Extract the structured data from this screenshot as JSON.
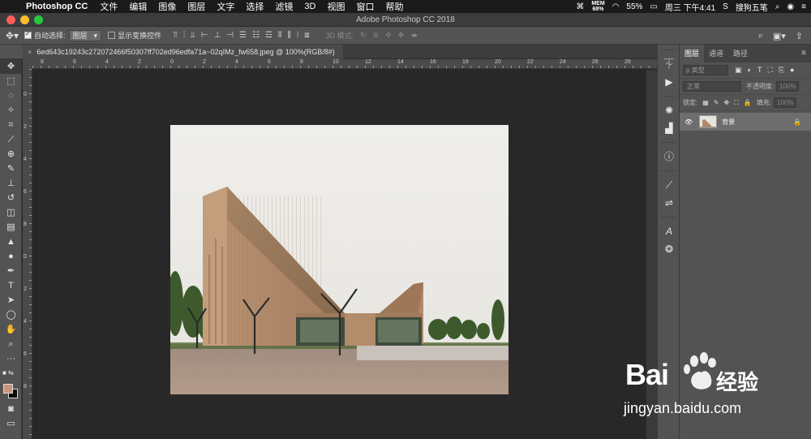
{
  "menubar": {
    "app_name": "Photoshop CC",
    "items": [
      "文件",
      "编辑",
      "图像",
      "图层",
      "文字",
      "选择",
      "滤镜",
      "3D",
      "视图",
      "窗口",
      "帮助"
    ],
    "mem_label": "MEM",
    "mem_value": "68%",
    "battery": "55%",
    "clock": "周三 下午4:41",
    "ime": "搜狗五笔"
  },
  "titlebar": {
    "title": "Adobe Photoshop CC 2018"
  },
  "options": {
    "auto_select_label": "自动选择:",
    "auto_select_value": "图层",
    "show_transform_label": "显示变换控件",
    "mode_3d_label": "3D 模式:"
  },
  "document": {
    "tab_title": "6ed643c19243c272072466f50307ff702ed96edfa71a~02qIMz_fw658.jpeg @ 100%(RGB/8#)",
    "close_glyph": "×"
  },
  "ruler": {
    "h_labels": [
      "8",
      "6",
      "4",
      "2",
      "0",
      "2",
      "4",
      "6",
      "8",
      "10",
      "12",
      "14",
      "16",
      "18",
      "20",
      "22",
      "24",
      "26",
      "28"
    ],
    "v_labels": [
      "0",
      "2",
      "4",
      "6",
      "8",
      "0",
      "2",
      "4",
      "6",
      "8"
    ]
  },
  "layers_panel": {
    "tabs": [
      "图层",
      "通道",
      "路径"
    ],
    "filter_placeholder": "ρ 类型",
    "blend_mode": "正常",
    "opacity_label": "不透明度:",
    "opacity_value": "100%",
    "lock_label": "锁定:",
    "fill_label": "填充:",
    "fill_value": "100%",
    "layers": [
      {
        "name": "背景",
        "locked": true,
        "visible": true
      }
    ]
  },
  "watermark": {
    "brand": "Bai",
    "brand_cn": "经验",
    "url": "jingyan.baidu.com"
  },
  "colors": {
    "foreground": "#c8957a",
    "background": "#0a0a0a"
  }
}
